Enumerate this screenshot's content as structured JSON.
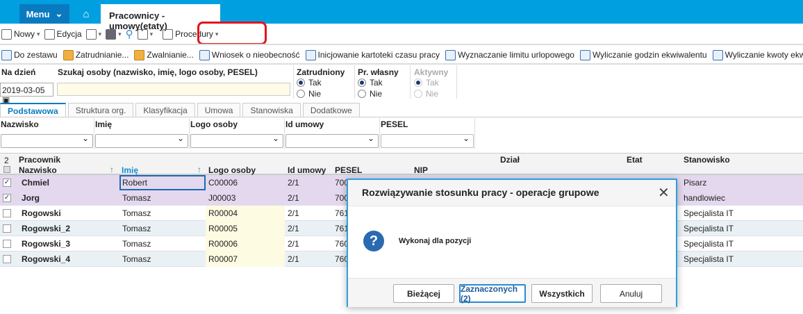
{
  "topbar": {
    "menu": "Menu",
    "tab_title": "Pracownicy - umowy(etaty)"
  },
  "toolbar": {
    "new": "Nowy",
    "edit": "Edycja",
    "procedures": "Procedury"
  },
  "toolbar2": [
    "Do zestawu",
    "Zatrudnianie...",
    "Zwalnianie...",
    "Wniosek o nieobecność",
    "Inicjowanie kartoteki czasu pracy",
    "Wyznaczanie limitu urlopowego",
    "Wyliczanie godzin ekwiwalentu",
    "Wyliczanie kwoty ekwiwalentu"
  ],
  "filters": {
    "date_label": "Na dzień",
    "date_value": "2019-03-05",
    "search_label": "Szukaj osoby (nazwisko, imię, logo osoby, PESEL)",
    "search_value": "",
    "employed": {
      "label": "Zatrudniony",
      "yes": "Tak",
      "no": "Nie"
    },
    "own": {
      "label": "Pr. własny",
      "yes": "Tak",
      "no": "Nie"
    },
    "active": {
      "label": "Aktywny",
      "yes": "Tak",
      "no": "Nie"
    }
  },
  "tabs": [
    "Podstawowa",
    "Struktura org.",
    "Klasyfikacja",
    "Umowa",
    "Stanowiska",
    "Dodatkowe"
  ],
  "filter_cols": [
    "Nazwisko",
    "Imię",
    "Logo osoby",
    "Id umowy",
    "PESEL"
  ],
  "grid": {
    "selected_count": "2",
    "group": "Pracownik",
    "headers": [
      "Nazwisko",
      "Imię",
      "Logo osoby",
      "Id umowy",
      "PESEL",
      "NIP",
      "Dział",
      "Etat",
      "Stanowisko"
    ],
    "rows": [
      {
        "checked": true,
        "nazwisko": "Chmiel",
        "imie": "Robert",
        "logo": "C00006",
        "id": "2/1",
        "pesel": "700",
        "stanowisko": "Pisarz"
      },
      {
        "checked": true,
        "nazwisko": "Jorg",
        "imie": "Tomasz",
        "logo": "J00003",
        "id": "2/1",
        "pesel": "700",
        "stanowisko": "handlowiec"
      },
      {
        "checked": false,
        "nazwisko": "Rogowski",
        "imie": "Tomasz",
        "logo": "R00004",
        "id": "2/1",
        "pesel": "761",
        "stanowisko": "Specjalista IT"
      },
      {
        "checked": false,
        "nazwisko": "Rogowski_2",
        "imie": "Tomasz",
        "logo": "R00005",
        "id": "2/1",
        "pesel": "761",
        "stanowisko": "Specjalista IT"
      },
      {
        "checked": false,
        "nazwisko": "Rogowski_3",
        "imie": "Tomasz",
        "logo": "R00006",
        "id": "2/1",
        "pesel": "760",
        "stanowisko": "Specjalista IT"
      },
      {
        "checked": false,
        "nazwisko": "Rogowski_4",
        "imie": "Tomasz",
        "logo": "R00007",
        "id": "2/1",
        "pesel": "760",
        "stanowisko": "Specjalista IT"
      }
    ]
  },
  "dialog": {
    "title": "Rozwiązywanie stosunku pracy - operacje grupowe",
    "message": "Wykonaj dla pozycji",
    "buttons": [
      "Bieżącej",
      "Zaznaczonych (2)",
      "Wszystkich",
      "Anuluj"
    ]
  }
}
